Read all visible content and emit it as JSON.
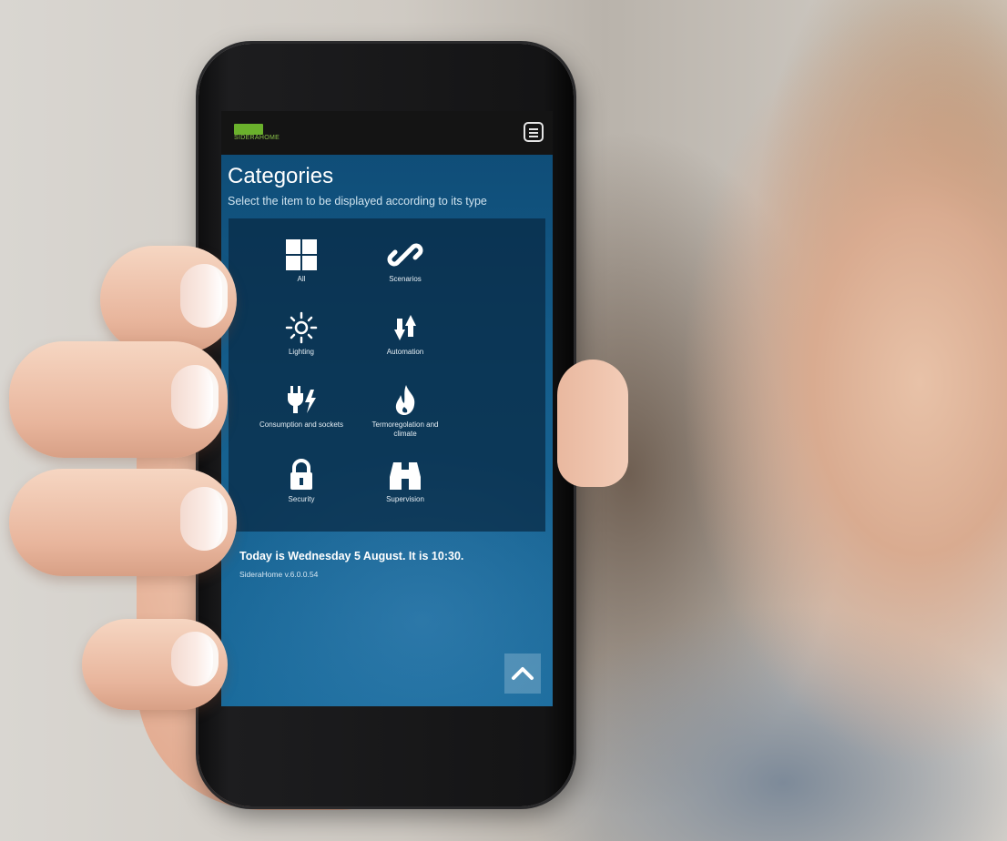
{
  "app": {
    "logo_text": "SIDERAHOME",
    "logo_badge": "UNE"
  },
  "header": {
    "title": "Categories",
    "subtitle": "Select the item to be displayed according to its type"
  },
  "categories": [
    {
      "label": "All",
      "icon": "grid-icon"
    },
    {
      "label": "Scenarios",
      "icon": "link-icon"
    },
    {
      "label": "Lighting",
      "icon": "sun-icon"
    },
    {
      "label": "Automation",
      "icon": "arrows-icon"
    },
    {
      "label": "Consumption and sockets",
      "icon": "plug-icon"
    },
    {
      "label": "Termoregolation and climate",
      "icon": "flame-icon"
    },
    {
      "label": "Security",
      "icon": "lock-icon"
    },
    {
      "label": "Supervision",
      "icon": "binoculars-icon"
    }
  ],
  "footer": {
    "today": "Today is Wednesday 5 August. It is 10:30.",
    "version": "SideraHome v.6.0.0.54"
  },
  "colors": {
    "accent": "#6ab12c",
    "screen_bg": "#155e8c",
    "topbar": "#141414"
  }
}
